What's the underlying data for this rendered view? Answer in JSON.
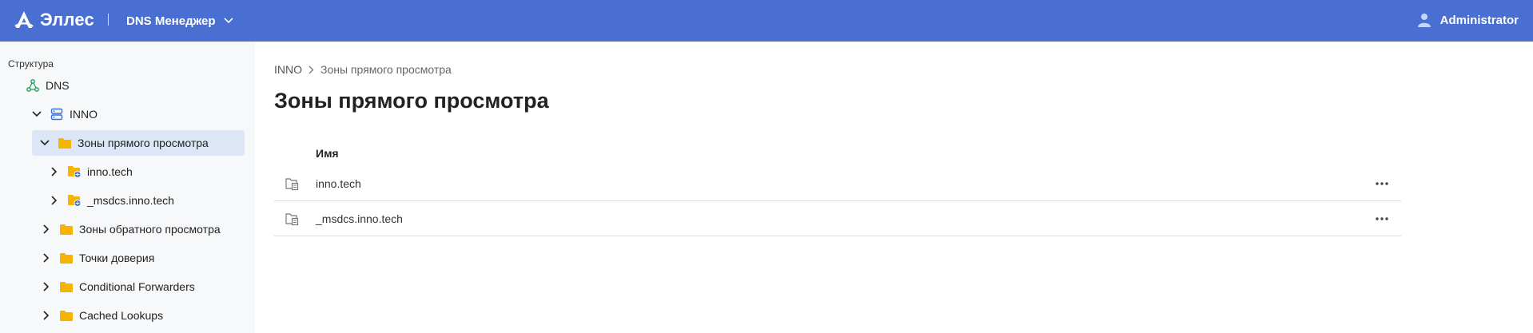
{
  "header": {
    "brand": "Эллес",
    "app_switcher": {
      "label": "DNS Менеджер"
    },
    "user": {
      "name": "Administrator"
    },
    "colors": {
      "background": "#4a6fd2"
    }
  },
  "sidebar": {
    "heading": "Структура",
    "tree": [
      {
        "label": "DNS",
        "icon": "network-icon",
        "expanded": true,
        "selected": false
      },
      {
        "label": "INNO",
        "icon": "server-icon",
        "expanded": true,
        "selected": false
      },
      {
        "label": "Зоны прямого просмотра",
        "icon": "folder-icon",
        "expanded": true,
        "selected": true
      },
      {
        "label": "inno.tech",
        "icon": "zone-folder-icon",
        "expanded": false,
        "selected": false
      },
      {
        "label": "_msdcs.inno.tech",
        "icon": "zone-folder-icon",
        "expanded": false,
        "selected": false
      },
      {
        "label": "Зоны обратного просмотра",
        "icon": "folder-icon",
        "expanded": false,
        "selected": false
      },
      {
        "label": "Точки доверия",
        "icon": "folder-icon",
        "expanded": false,
        "selected": false
      },
      {
        "label": "Conditional Forwarders",
        "icon": "folder-icon",
        "expanded": false,
        "selected": false
      },
      {
        "label": "Cached Lookups",
        "icon": "folder-icon",
        "expanded": false,
        "selected": false
      }
    ],
    "colors": {
      "background": "#f7f8fa",
      "selected": "#dce6f7",
      "folder": "#f5b400",
      "accent": "#2f6fe0",
      "dns": "#1e9e5a"
    }
  },
  "main": {
    "breadcrumb": [
      "INNO",
      "Зоны прямого просмотра"
    ],
    "title": "Зоны прямого просмотра",
    "table": {
      "columns": [
        "Имя"
      ],
      "rows": [
        {
          "name": "inno.tech",
          "icon": "zone-file-icon"
        },
        {
          "name": "_msdcs.inno.tech",
          "icon": "zone-file-icon"
        }
      ]
    }
  }
}
